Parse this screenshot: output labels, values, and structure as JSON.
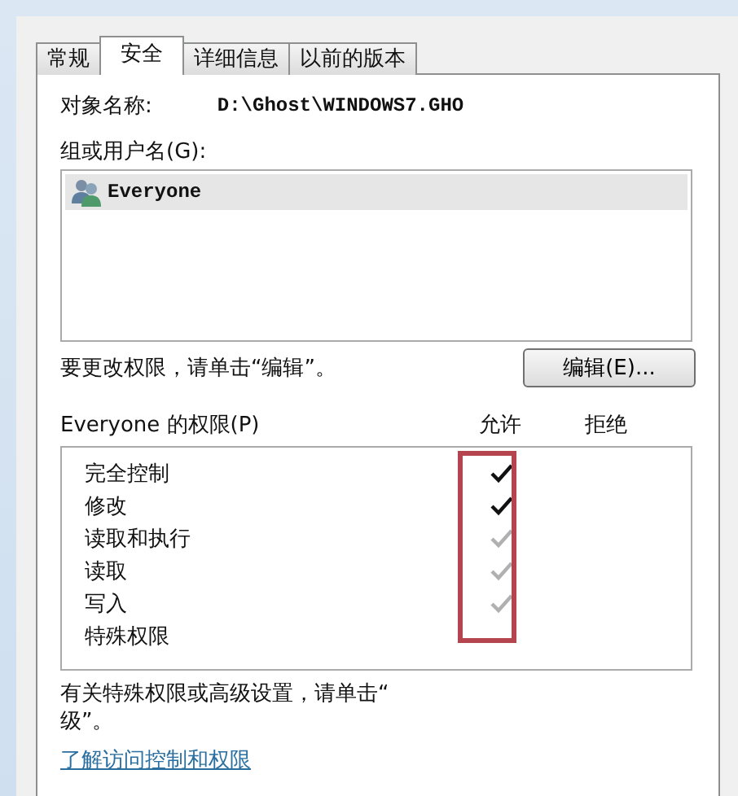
{
  "tabs": [
    {
      "label": "常规",
      "selected": false
    },
    {
      "label": "安全",
      "selected": true
    },
    {
      "label": "详细信息",
      "selected": false
    },
    {
      "label": "以前的版本",
      "selected": false
    }
  ],
  "object_name": {
    "label": "对象名称:",
    "value": "D:\\Ghost\\WINDOWS7.GHO"
  },
  "groups": {
    "label": "组或用户名(G):",
    "items": [
      {
        "name": "Everyone",
        "selected": true
      }
    ]
  },
  "edit_hint": "要更改权限，请单击“编辑”。",
  "edit_button": "编辑(E)...",
  "permissions": {
    "title": "Everyone 的权限(P)",
    "allow_header": "允许",
    "deny_header": "拒绝",
    "rows": [
      {
        "name": "完全控制",
        "allow": true,
        "dimmed": false
      },
      {
        "name": "修改",
        "allow": true,
        "dimmed": false
      },
      {
        "name": "读取和执行",
        "allow": true,
        "dimmed": true
      },
      {
        "name": "读取",
        "allow": true,
        "dimmed": true
      },
      {
        "name": "写入",
        "allow": true,
        "dimmed": true
      },
      {
        "name": "特殊权限",
        "allow": false
      }
    ]
  },
  "advanced_hint": [
    "有关特殊权限或高级设置，请单击“",
    "级”。"
  ],
  "link": "了解访问控制和权限"
}
